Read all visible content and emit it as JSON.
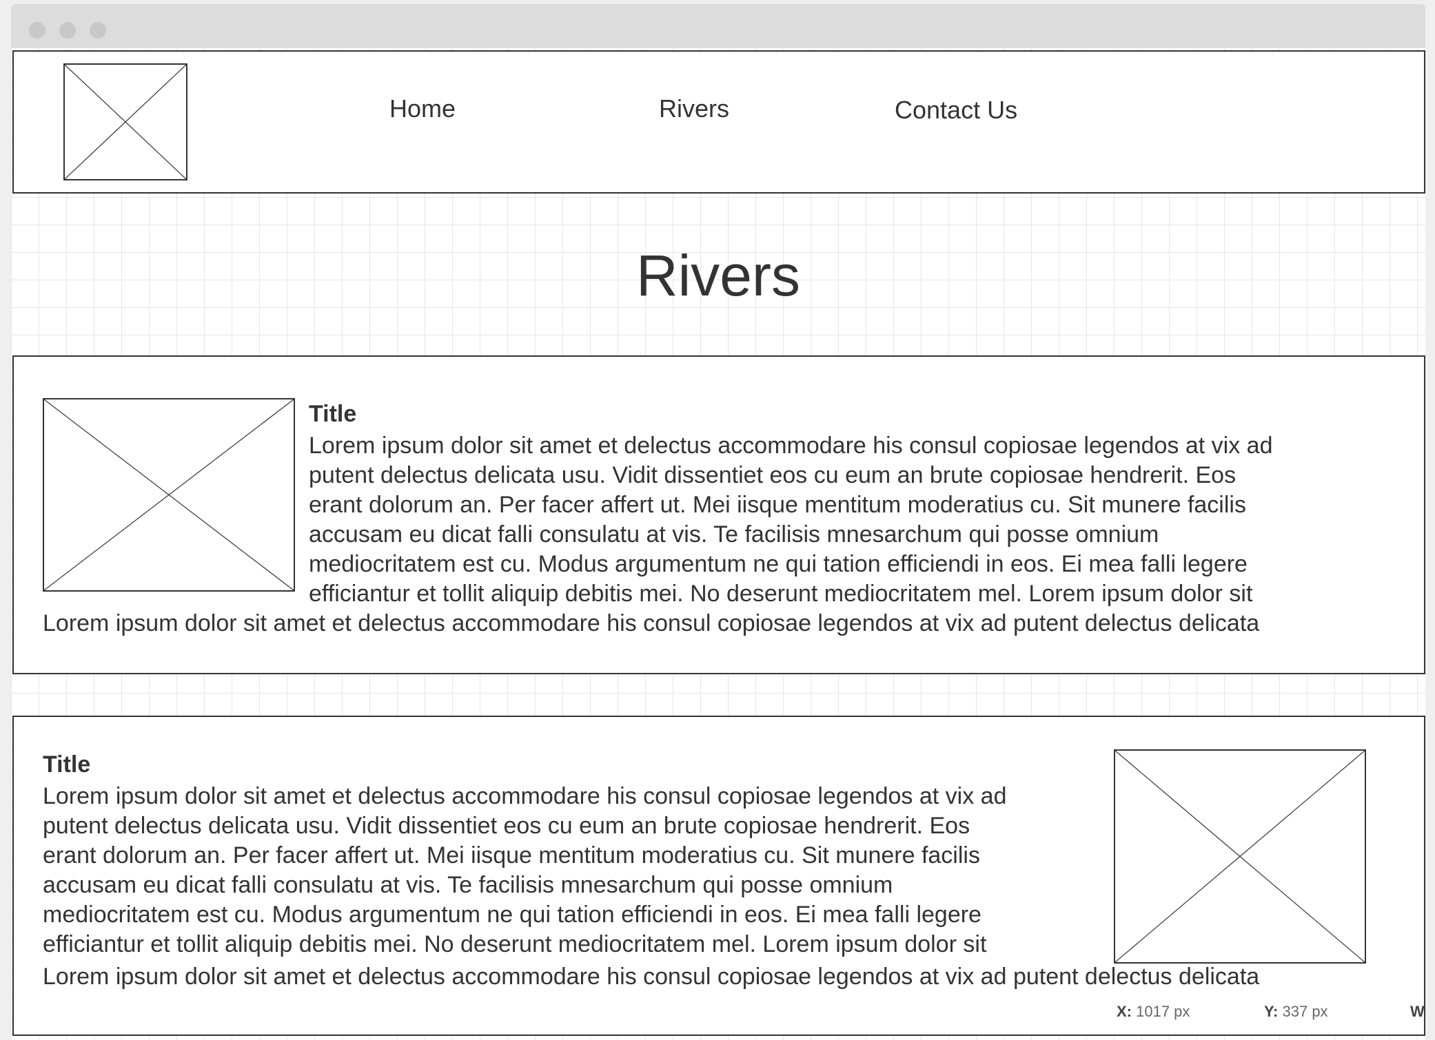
{
  "nav": {
    "items": [
      {
        "label": "Home"
      },
      {
        "label": "Rivers"
      },
      {
        "label": "Contact Us"
      }
    ]
  },
  "page": {
    "title": "Rivers"
  },
  "articles": [
    {
      "title": "Title",
      "lines": [
        "Lorem ipsum dolor sit amet et delectus accommodare his consul copiosae legendos at vix ad",
        "putent delectus delicata usu. Vidit dissentiet eos cu eum an brute copiosae hendrerit. Eos",
        "erant dolorum an. Per facer affert ut. Mei iisque mentitum moderatius cu. Sit munere facilis",
        "accusam eu dicat falli consulatu at vis. Te facilisis mnesarchum qui posse omnium",
        "mediocritatem est cu. Modus argumentum ne qui tation efficiendi in eos. Ei mea falli legere",
        "efficiantur et tollit aliquip debitis mei. No deserunt mediocritatem mel. Lorem ipsum dolor sit"
      ],
      "tail": "Lorem ipsum dolor sit amet et delectus accommodare his consul copiosae legendos at vix ad putent delectus delicata"
    },
    {
      "title": "Title",
      "lines": [
        "Lorem ipsum dolor sit amet et delectus accommodare his consul copiosae legendos at vix ad",
        "putent delectus delicata usu. Vidit dissentiet eos cu eum an brute copiosae hendrerit. Eos",
        "erant dolorum an. Per facer affert ut. Mei iisque mentitum moderatius cu. Sit munere facilis",
        "accusam eu dicat falli consulatu at vis. Te facilisis mnesarchum qui posse omnium",
        "mediocritatem est cu. Modus argumentum ne qui tation efficiendi in eos. Ei mea falli legere",
        "efficiantur et tollit aliquip debitis mei. No deserunt mediocritatem mel. Lorem ipsum dolor sit"
      ],
      "tail": "Lorem ipsum dolor sit amet et delectus accommodare his consul copiosae legendos at vix ad putent delectus delicata"
    }
  ],
  "status": {
    "x_label": "X:",
    "x_value": "1017 px",
    "y_label": "Y:",
    "y_value": "337 px",
    "w_label": "W:"
  },
  "colors": {
    "ink": "#333333",
    "titlebar": "#dcdcdc",
    "grid": "#e6e6e6"
  }
}
